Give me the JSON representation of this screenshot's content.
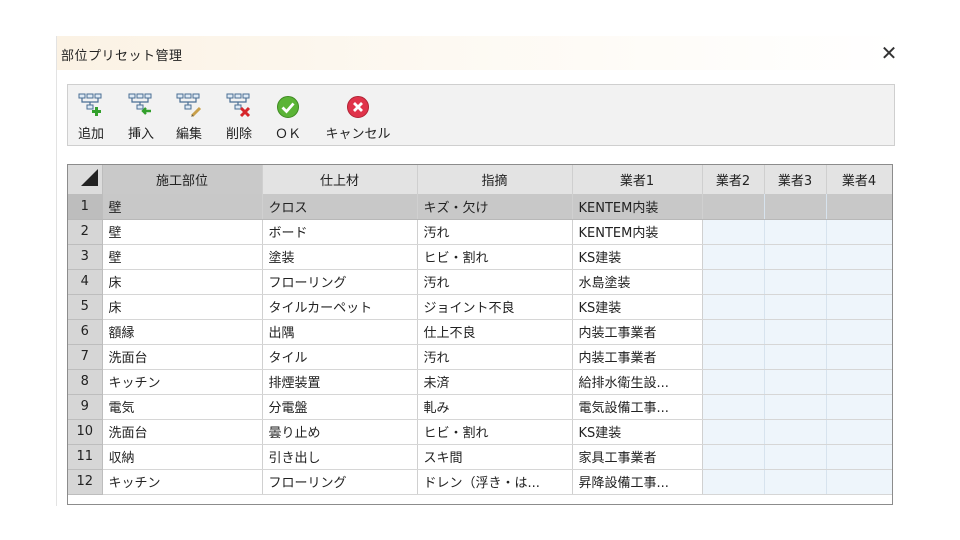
{
  "window": {
    "title": "部位プリセット管理",
    "close_glyph": "✕"
  },
  "toolbar": {
    "items": [
      {
        "label": "追加",
        "icon": "add-icon"
      },
      {
        "label": "挿入",
        "icon": "insert-icon"
      },
      {
        "label": "編集",
        "icon": "edit-icon"
      },
      {
        "label": "削除",
        "icon": "delete-icon"
      },
      {
        "label": "ＯＫ",
        "icon": "ok-icon"
      },
      {
        "label": "キャンセル",
        "icon": "cancel-icon"
      }
    ]
  },
  "grid": {
    "columns": [
      "施工部位",
      "仕上材",
      "指摘",
      "業者1",
      "業者2",
      "業者3",
      "業者4"
    ],
    "selected_row": 1,
    "rows": [
      {
        "no": "1",
        "cells": [
          "壁",
          "クロス",
          "キズ・欠け",
          "KENTEM内装",
          "",
          "",
          ""
        ]
      },
      {
        "no": "2",
        "cells": [
          "壁",
          "ボード",
          "汚れ",
          "KENTEM内装",
          "",
          "",
          ""
        ]
      },
      {
        "no": "3",
        "cells": [
          "壁",
          "塗装",
          "ヒビ・割れ",
          "KS建装",
          "",
          "",
          ""
        ]
      },
      {
        "no": "4",
        "cells": [
          "床",
          "フローリング",
          "汚れ",
          "水島塗装",
          "",
          "",
          ""
        ]
      },
      {
        "no": "5",
        "cells": [
          "床",
          "タイルカーペット",
          "ジョイント不良",
          "KS建装",
          "",
          "",
          ""
        ]
      },
      {
        "no": "6",
        "cells": [
          "額縁",
          "出隅",
          "仕上不良",
          "内装工事業者",
          "",
          "",
          ""
        ]
      },
      {
        "no": "7",
        "cells": [
          "洗面台",
          "タイル",
          "汚れ",
          "内装工事業者",
          "",
          "",
          ""
        ]
      },
      {
        "no": "8",
        "cells": [
          "キッチン",
          "排煙装置",
          "未済",
          "給排水衛生設...",
          "",
          "",
          ""
        ]
      },
      {
        "no": "9",
        "cells": [
          "電気",
          "分電盤",
          "軋み",
          "電気設備工事...",
          "",
          "",
          ""
        ]
      },
      {
        "no": "10",
        "cells": [
          "洗面台",
          "曇り止め",
          "ヒビ・割れ",
          "KS建装",
          "",
          "",
          ""
        ]
      },
      {
        "no": "11",
        "cells": [
          "収納",
          "引き出し",
          "スキ間",
          "家具工事業者",
          "",
          "",
          ""
        ]
      },
      {
        "no": "12",
        "cells": [
          "キッチン",
          "フローリング",
          "ドレン（浮き・は...",
          "昇降設備工事...",
          "",
          "",
          ""
        ]
      }
    ]
  }
}
